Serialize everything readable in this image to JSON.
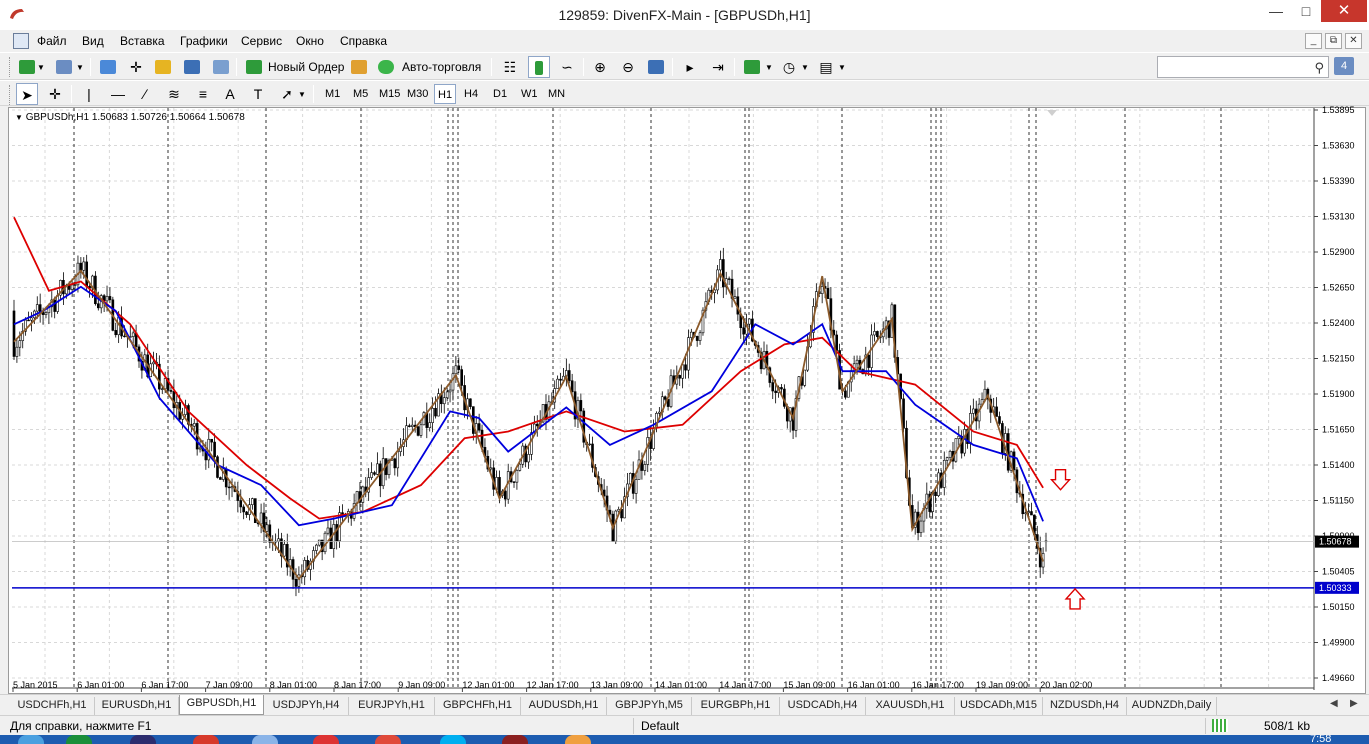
{
  "window": {
    "title": "129859: DivenFX-Main - [GBPUSDh,H1]"
  },
  "menu": [
    "Файл",
    "Вид",
    "Вставка",
    "Графики",
    "Сервис",
    "Окно",
    "Справка"
  ],
  "toolbar": {
    "new_order_label": "Новый Ордер",
    "auto_trading_label": "Авто-торговля",
    "search_placeholder": "",
    "notification_count": "4"
  },
  "timeframes": [
    "M1",
    "M5",
    "M15",
    "M30",
    "H1",
    "H4",
    "D1",
    "W1",
    "MN"
  ],
  "active_timeframe": "H1",
  "chart_header": "GBPUSDh,H1  1.50683 1.50726 1.50664 1.50678",
  "symbol_tabs": [
    "USDCHFh,H1",
    "EURUSDh,H1",
    "GBPUSDh,H1",
    "USDJPYh,H4",
    "EURJPYh,H1",
    "GBPCHFh,H1",
    "AUDUSDh,H1",
    "GBPJPYh,M5",
    "EURGBPh,H1",
    "USDCADh,H4",
    "XAUUSDh,H1",
    "USDCADh,M15",
    "NZDUSDh,H4",
    "AUDNZDh,Daily"
  ],
  "active_tab": "GBPUSDh,H1",
  "status": {
    "help": "Для справки, нажмите F1",
    "profile": "Default",
    "traffic": "508/1 kb"
  },
  "taskbar": {
    "clock": "7:58"
  },
  "colors": {
    "ma_fast": "#0000dd",
    "ma_slow": "#dd0000",
    "zigzag": "#8b5a2b",
    "level_line": "#0000cc",
    "arrow": "#dd0000",
    "current_price_bg": "#000000"
  },
  "chart_data": {
    "type": "candlestick",
    "symbol": "GBPUSDh",
    "timeframe": "H1",
    "ylim": [
      1.4966,
      1.539
    ],
    "y_ticks": [
      "1.53895",
      "1.53630",
      "1.53390",
      "1.53130",
      "1.52900",
      "1.52650",
      "1.52400",
      "1.52150",
      "1.51900",
      "1.51650",
      "1.51400",
      "1.51150",
      "1.50900",
      "1.50405",
      "1.50150",
      "1.49900",
      "1.49660"
    ],
    "x_ticks": [
      "5 Jan 2015",
      "6 Jan 01:00",
      "6 Jan 17:00",
      "7 Jan 09:00",
      "8 Jan 01:00",
      "8 Jan 17:00",
      "9 Jan 09:00",
      "12 Jan 01:00",
      "12 Jan 17:00",
      "13 Jan 09:00",
      "14 Jan 01:00",
      "14 Jan 17:00",
      "15 Jan 09:00",
      "16 Jan 01:00",
      "16 Jan 17:00",
      "19 Jan 09:00",
      "20 Jan 02:00"
    ],
    "current_price": "1.50678",
    "level_price": "1.50333",
    "ohlc_last": {
      "open": 1.50683,
      "high": 1.50726,
      "low": 1.50664,
      "close": 1.50678
    },
    "zigzag_pivots": [
      {
        "t": 0,
        "p": 1.5217
      },
      {
        "t": 23,
        "p": 1.527
      },
      {
        "t": 98,
        "p": 1.504
      },
      {
        "t": 152,
        "p": 1.5192
      },
      {
        "t": 167,
        "p": 1.51
      },
      {
        "t": 190,
        "p": 1.5191
      },
      {
        "t": 206,
        "p": 1.5078
      },
      {
        "t": 243,
        "p": 1.5268
      },
      {
        "t": 268,
        "p": 1.516
      },
      {
        "t": 278,
        "p": 1.5266
      },
      {
        "t": 285,
        "p": 1.518
      },
      {
        "t": 302,
        "p": 1.5234
      },
      {
        "t": 309,
        "p": 1.5077
      },
      {
        "t": 335,
        "p": 1.5177
      },
      {
        "t": 354,
        "p": 1.5053
      }
    ],
    "ma_fast_path": [
      [
        0,
        1.523
      ],
      [
        10,
        1.524
      ],
      [
        23,
        1.5258
      ],
      [
        35,
        1.524
      ],
      [
        50,
        1.5175
      ],
      [
        70,
        1.5125
      ],
      [
        85,
        1.511
      ],
      [
        98,
        1.508
      ],
      [
        110,
        1.5085
      ],
      [
        130,
        1.5095
      ],
      [
        150,
        1.5165
      ],
      [
        160,
        1.516
      ],
      [
        170,
        1.5135
      ],
      [
        190,
        1.5168
      ],
      [
        205,
        1.514
      ],
      [
        220,
        1.5155
      ],
      [
        240,
        1.518
      ],
      [
        255,
        1.523
      ],
      [
        268,
        1.5215
      ],
      [
        278,
        1.523
      ],
      [
        285,
        1.5195
      ],
      [
        300,
        1.5195
      ],
      [
        310,
        1.517
      ],
      [
        330,
        1.514
      ],
      [
        345,
        1.513
      ],
      [
        354,
        1.5083
      ]
    ],
    "ma_slow_path": [
      [
        0,
        1.531
      ],
      [
        12,
        1.5255
      ],
      [
        23,
        1.5262
      ],
      [
        40,
        1.523
      ],
      [
        60,
        1.5165
      ],
      [
        80,
        1.5125
      ],
      [
        95,
        1.51
      ],
      [
        105,
        1.5085
      ],
      [
        120,
        1.509
      ],
      [
        140,
        1.511
      ],
      [
        155,
        1.5145
      ],
      [
        170,
        1.515
      ],
      [
        190,
        1.5165
      ],
      [
        210,
        1.515
      ],
      [
        230,
        1.5155
      ],
      [
        250,
        1.5195
      ],
      [
        265,
        1.5215
      ],
      [
        278,
        1.522
      ],
      [
        290,
        1.5195
      ],
      [
        310,
        1.5185
      ],
      [
        330,
        1.515
      ],
      [
        345,
        1.514
      ],
      [
        354,
        1.5108
      ]
    ],
    "signal_arrows": [
      {
        "t": 360,
        "p": 1.5114,
        "dir": "down"
      },
      {
        "t": 365,
        "p": 1.5025,
        "dir": "up"
      }
    ],
    "candle_count": 356,
    "grid": false
  }
}
